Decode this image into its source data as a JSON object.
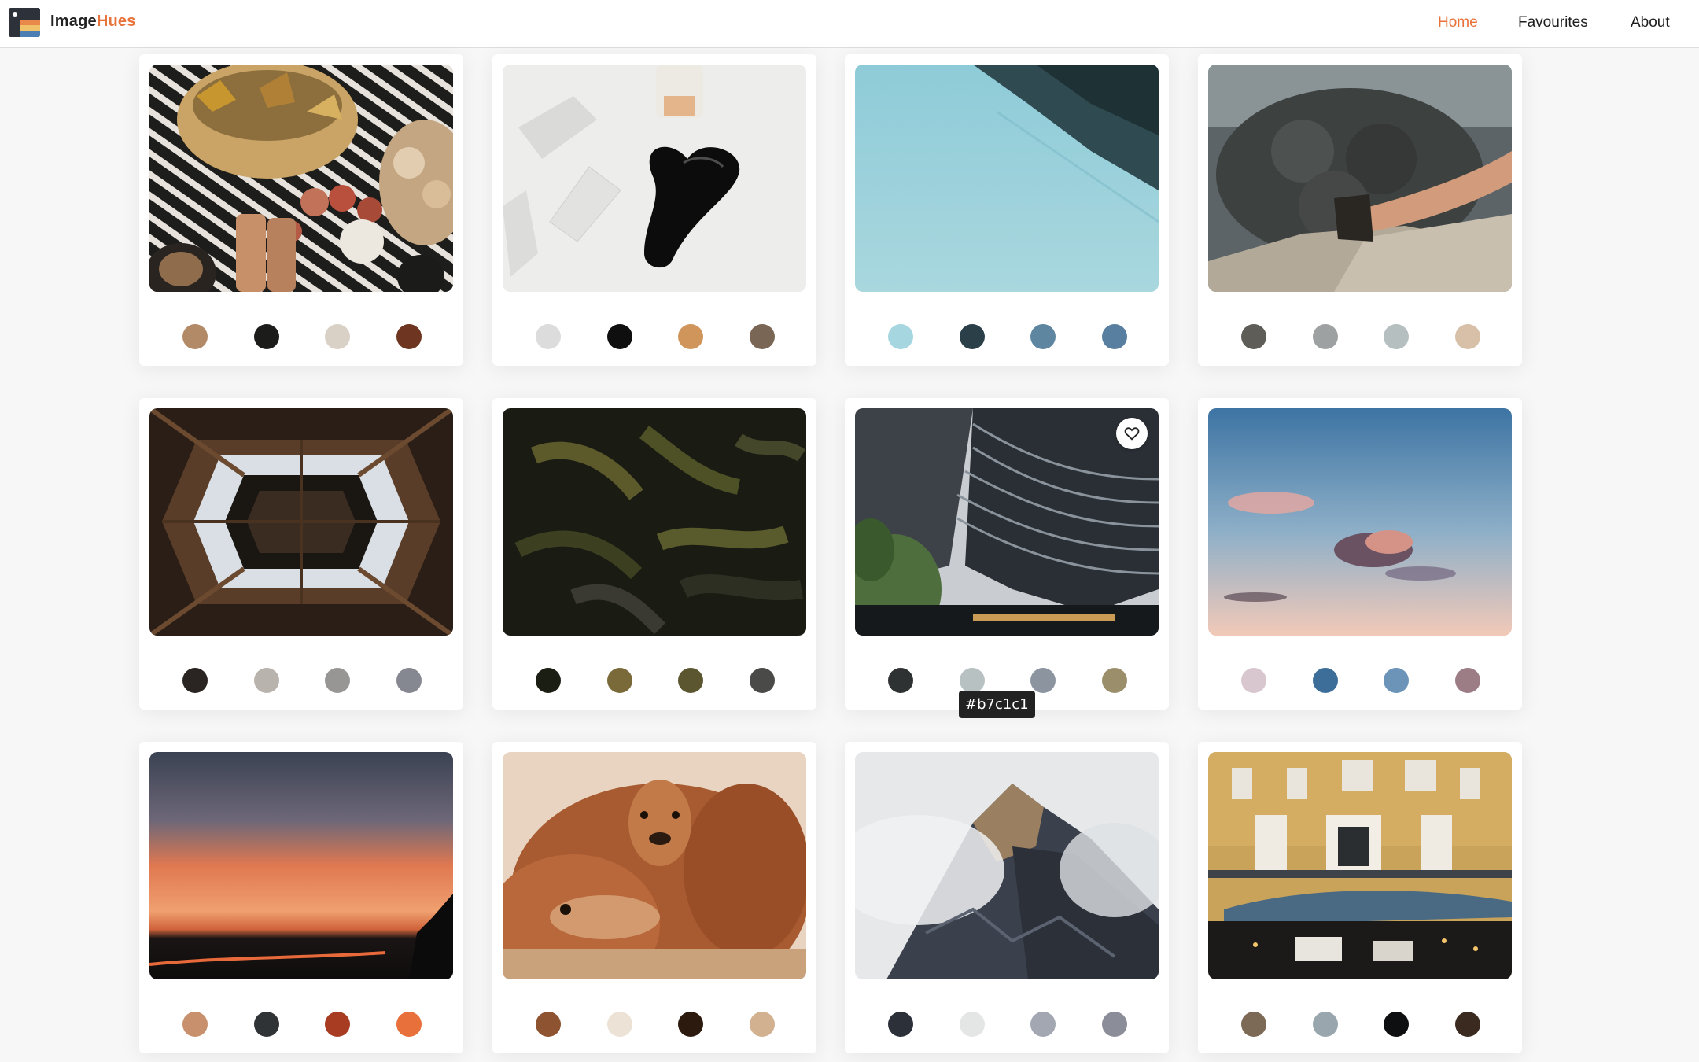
{
  "app": {
    "brand_main": "Image",
    "brand_accent": "Hues"
  },
  "nav": {
    "items": [
      {
        "label": "Home",
        "active": true
      },
      {
        "label": "Favourites",
        "active": false
      },
      {
        "label": "About",
        "active": false
      }
    ]
  },
  "tooltip": {
    "text": "#b7c1c1"
  },
  "colors": {
    "accent": "#e8733a",
    "background": "#f7f7f7"
  },
  "cards": [
    {
      "subject": "autumn picnic basket with pumpkins",
      "favourite_icon_visible": false,
      "swatches": [
        "#b38a68",
        "#1c1c1a",
        "#d9d0c6",
        "#6e3620"
      ]
    },
    {
      "subject": "black gua sha stone with crystals",
      "favourite_icon_visible": false,
      "swatches": [
        "#dcdcdc",
        "#0f0f0f",
        "#cf955a",
        "#7a6654"
      ]
    },
    {
      "subject": "calm light blue water",
      "favourite_icon_visible": false,
      "swatches": [
        "#a6d6e0",
        "#2b3f48",
        "#5f86a0",
        "#587f9f"
      ]
    },
    {
      "subject": "legs on rock by plants",
      "favourite_icon_visible": false,
      "swatches": [
        "#5e5d57",
        "#9ea1a1",
        "#b6bfc0",
        "#d8c0a8"
      ]
    },
    {
      "subject": "Eiffel tower from below",
      "favourite_icon_visible": false,
      "swatches": [
        "#2a2522",
        "#b9b3ae",
        "#979695",
        "#868891"
      ]
    },
    {
      "subject": "dark green fern leaves",
      "favourite_icon_visible": false,
      "swatches": [
        "#1b1e12",
        "#7a6a3a",
        "#5c5630",
        "#4a4a48"
      ]
    },
    {
      "subject": "curved glass skyscraper",
      "favourite_icon_visible": true,
      "swatches": [
        "#2f3233",
        "#b7c1c1",
        "#8c94a0",
        "#9a8f6a"
      ]
    },
    {
      "subject": "pastel sky with clouds",
      "favourite_icon_visible": false,
      "swatches": [
        "#d9c7cf",
        "#3c6e99",
        "#6b94b8",
        "#9c7c85"
      ]
    },
    {
      "subject": "orange sunset horizon",
      "favourite_icon_visible": false,
      "swatches": [
        "#c9906e",
        "#2f3335",
        "#a83c22",
        "#e8703a"
      ]
    },
    {
      "subject": "group of antelopes",
      "favourite_icon_visible": false,
      "swatches": [
        "#8e5432",
        "#ece2d6",
        "#2c1a0e",
        "#d2b191"
      ]
    },
    {
      "subject": "misty mountain peak",
      "favourite_icon_visible": false,
      "swatches": [
        "#2c3039",
        "#e4e5e5",
        "#a2a7b2",
        "#8b8e98"
      ]
    },
    {
      "subject": "yellow building with cafe",
      "favourite_icon_visible": false,
      "swatches": [
        "#7d6a56",
        "#9aa6ae",
        "#0e0f10",
        "#3b2a20"
      ]
    }
  ]
}
